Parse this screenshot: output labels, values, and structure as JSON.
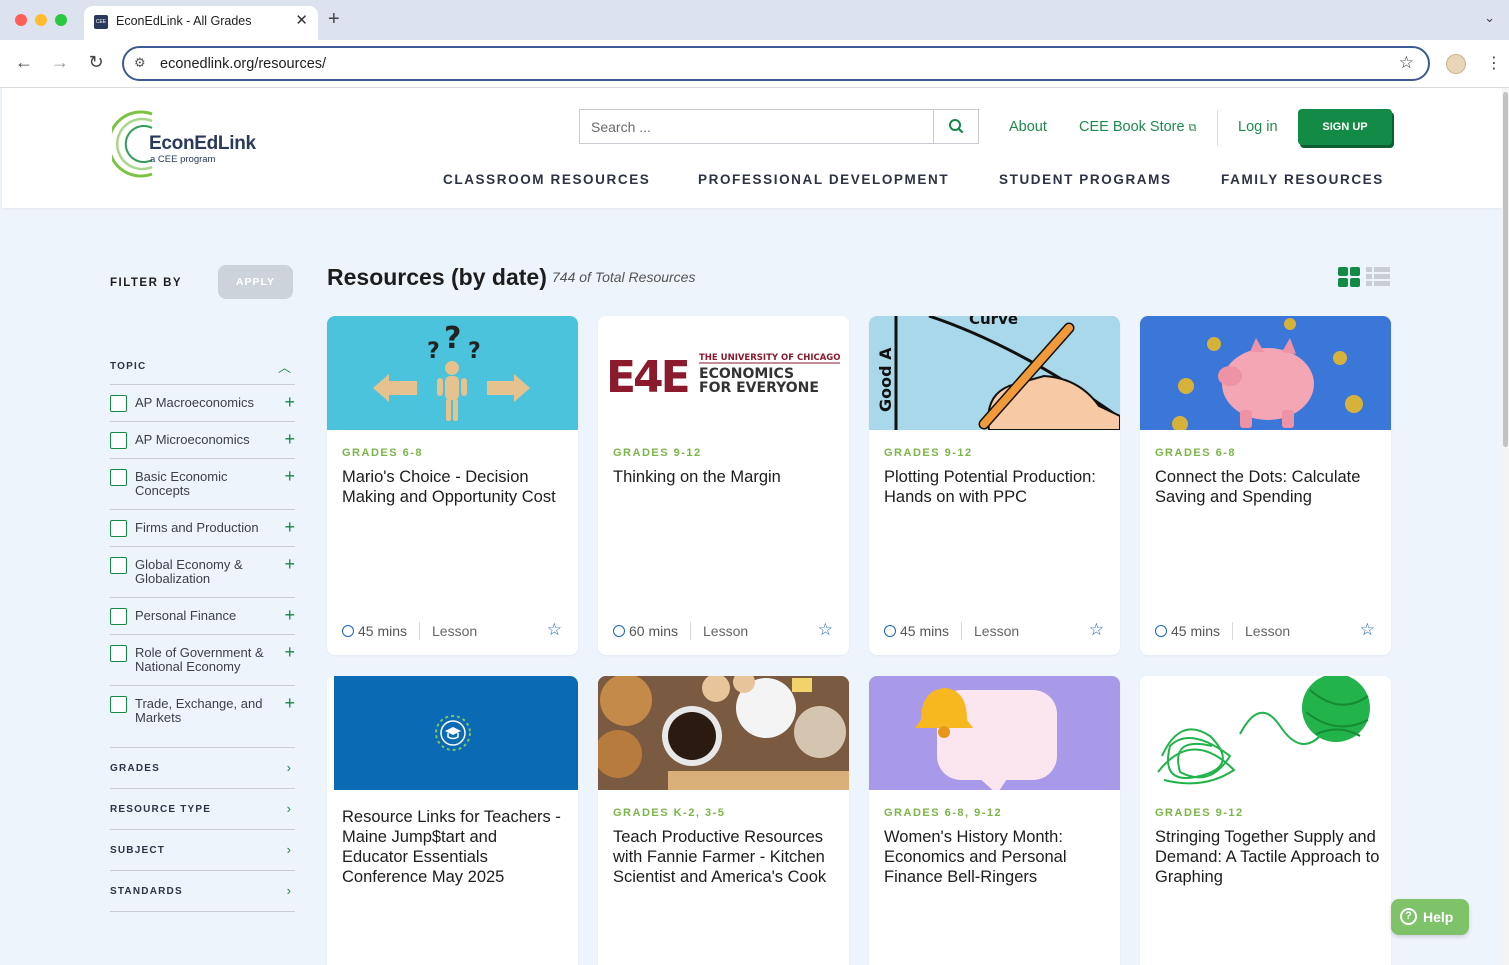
{
  "browser": {
    "tab_title": "EconEdLink - All Grades",
    "favicon_text": "CEE",
    "url": "econedlink.org/resources/"
  },
  "header": {
    "logo_title": "EconEdLink",
    "logo_subtitle": "a CEE program",
    "search_placeholder": "Search ...",
    "about": "About",
    "bookstore": "CEE Book Store",
    "login": "Log in",
    "signup": "SIGN UP",
    "nav": [
      "CLASSROOM RESOURCES",
      "PROFESSIONAL DEVELOPMENT",
      "STUDENT PROGRAMS",
      "FAMILY RESOURCES"
    ]
  },
  "sidebar": {
    "filter_label": "FILTER BY",
    "apply": "APPLY",
    "topic_label": "TOPIC",
    "topics": [
      {
        "label": "AP Macroeconomics",
        "checked": false
      },
      {
        "label": "AP Microeconomics",
        "checked": false
      },
      {
        "label": "Basic Economic Concepts",
        "checked": false
      },
      {
        "label": "Firms and Production",
        "checked": false
      },
      {
        "label": "Global Economy & Globalization",
        "checked": false
      },
      {
        "label": "Personal Finance",
        "checked": false
      },
      {
        "label": "Role of Government & National Economy",
        "checked": false
      },
      {
        "label": "Trade, Exchange, and Markets",
        "checked": false
      }
    ],
    "sections": [
      "GRADES",
      "RESOURCE TYPE",
      "SUBJECT",
      "STANDARDS"
    ]
  },
  "main": {
    "title": "Resources (by date)",
    "count": "744 of Total Resources",
    "cards": [
      {
        "grade": "GRADES 6-8",
        "title": "Mario's Choice - Decision Making and Opportunity Cost",
        "time": "45 mins",
        "type": "Lesson",
        "image": "question-figure-arrows"
      },
      {
        "grade": "GRADES 9-12",
        "title": "Thinking on the Margin",
        "time": "60 mins",
        "type": "Lesson",
        "image": "economics-for-everyone-logo"
      },
      {
        "grade": "GRADES 9-12",
        "title": "Plotting Potential Production: Hands on with PPC",
        "time": "45 mins",
        "type": "Lesson",
        "image": "hand-drawing-curve"
      },
      {
        "grade": "GRADES 6-8",
        "title": "Connect the Dots: Calculate Saving and Spending",
        "time": "45 mins",
        "type": "Lesson",
        "image": "piggy-bank-coins"
      },
      {
        "grade": "",
        "title": "Resource Links for Teachers - Maine Jump$tart and Educator Essentials Conference May 2025",
        "image": "graduation-cap-laurel"
      },
      {
        "grade": "GRADES K-2, 3-5",
        "title": "Teach Productive Resources with Fannie Farmer - Kitchen Scientist and America's Cook",
        "image": "baking-ingredients"
      },
      {
        "grade": "GRADES 6-8, 9-12",
        "title": "Women's History Month: Economics and Personal Finance Bell-Ringers",
        "image": "bell-speech-bubble"
      },
      {
        "grade": "GRADES 9-12",
        "title": "Stringing Together Supply and Demand: A Tactile Approach to Graphing",
        "image": "green-yarn"
      }
    ],
    "logo_texts": {
      "e4e_mark": "E4E",
      "e4e_univ": "THE UNIVERSITY OF CHICAGO",
      "e4e_line1": "ECONOMICS",
      "e4e_line2": "FOR EVERYONE",
      "ppc_axis": "Good A",
      "ppc_curve": "Curve"
    }
  },
  "help": {
    "label": "Help"
  },
  "colors": {
    "accent": "#138a45",
    "link": "#1f8a4c",
    "grade": "#7ab646",
    "icon_blue": "#1565c0"
  }
}
